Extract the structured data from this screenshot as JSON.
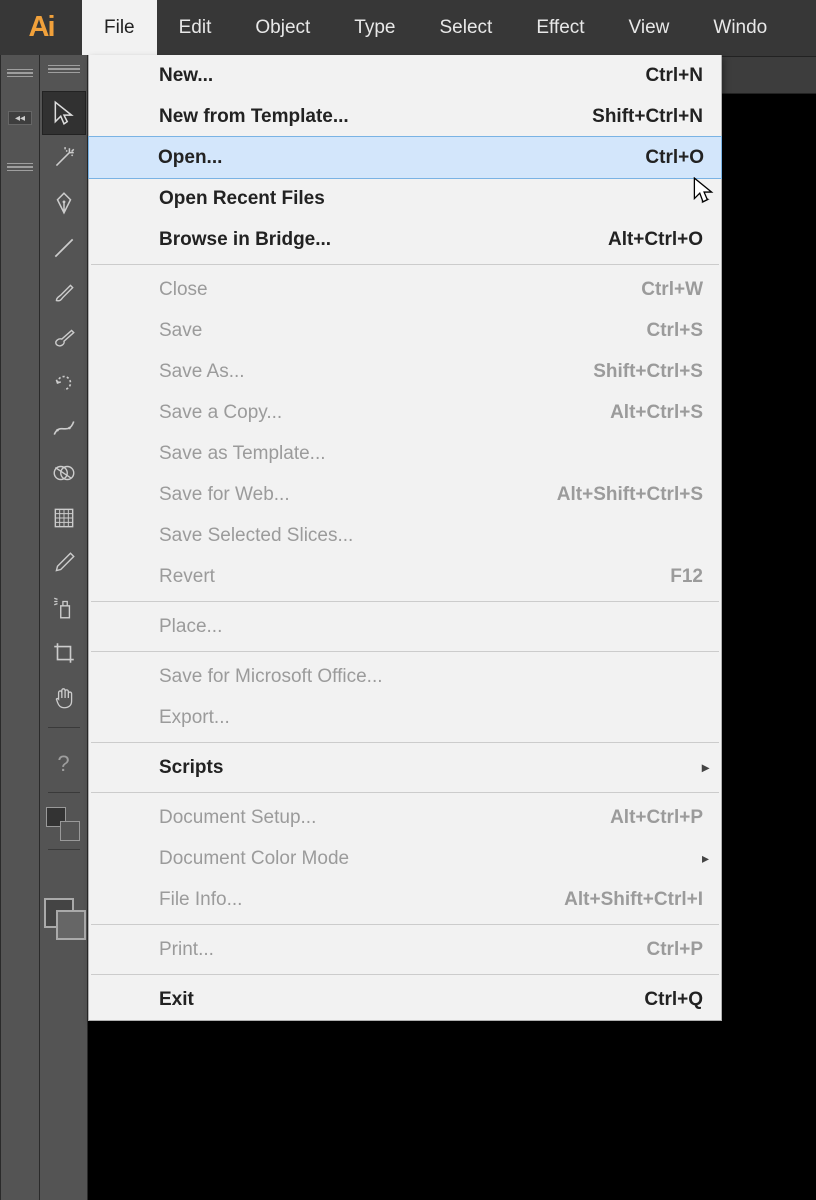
{
  "app_logo_text": "Ai",
  "menubar": {
    "items": [
      {
        "label": "File"
      },
      {
        "label": "Edit"
      },
      {
        "label": "Object"
      },
      {
        "label": "Type"
      },
      {
        "label": "Select"
      },
      {
        "label": "Effect"
      },
      {
        "label": "View"
      },
      {
        "label": "Windo"
      }
    ]
  },
  "file_menu": {
    "items": [
      {
        "label": "New...",
        "shortcut": "Ctrl+N",
        "disabled": false,
        "submenu": false,
        "hover": false
      },
      {
        "label": "New from Template...",
        "shortcut": "Shift+Ctrl+N",
        "disabled": false,
        "submenu": false,
        "hover": false
      },
      {
        "label": "Open...",
        "shortcut": "Ctrl+O",
        "disabled": false,
        "submenu": false,
        "hover": true
      },
      {
        "label": "Open Recent Files",
        "shortcut": "",
        "disabled": false,
        "submenu": true,
        "hover": false
      },
      {
        "label": "Browse in Bridge...",
        "shortcut": "Alt+Ctrl+O",
        "disabled": false,
        "submenu": false,
        "hover": false
      },
      {
        "sep": true
      },
      {
        "label": "Close",
        "shortcut": "Ctrl+W",
        "disabled": true,
        "submenu": false,
        "hover": false
      },
      {
        "label": "Save",
        "shortcut": "Ctrl+S",
        "disabled": true,
        "submenu": false,
        "hover": false
      },
      {
        "label": "Save As...",
        "shortcut": "Shift+Ctrl+S",
        "disabled": true,
        "submenu": false,
        "hover": false
      },
      {
        "label": "Save a Copy...",
        "shortcut": "Alt+Ctrl+S",
        "disabled": true,
        "submenu": false,
        "hover": false
      },
      {
        "label": "Save as Template...",
        "shortcut": "",
        "disabled": true,
        "submenu": false,
        "hover": false
      },
      {
        "label": "Save for Web...",
        "shortcut": "Alt+Shift+Ctrl+S",
        "disabled": true,
        "submenu": false,
        "hover": false
      },
      {
        "label": "Save Selected Slices...",
        "shortcut": "",
        "disabled": true,
        "submenu": false,
        "hover": false
      },
      {
        "label": "Revert",
        "shortcut": "F12",
        "disabled": true,
        "submenu": false,
        "hover": false
      },
      {
        "sep": true
      },
      {
        "label": "Place...",
        "shortcut": "",
        "disabled": true,
        "submenu": false,
        "hover": false
      },
      {
        "sep": true
      },
      {
        "label": "Save for Microsoft Office...",
        "shortcut": "",
        "disabled": true,
        "submenu": false,
        "hover": false
      },
      {
        "label": "Export...",
        "shortcut": "",
        "disabled": true,
        "submenu": false,
        "hover": false
      },
      {
        "sep": true
      },
      {
        "label": "Scripts",
        "shortcut": "",
        "disabled": false,
        "submenu": true,
        "hover": false
      },
      {
        "sep": true
      },
      {
        "label": "Document Setup...",
        "shortcut": "Alt+Ctrl+P",
        "disabled": true,
        "submenu": false,
        "hover": false
      },
      {
        "label": "Document Color Mode",
        "shortcut": "",
        "disabled": true,
        "submenu": true,
        "hover": false
      },
      {
        "label": "File Info...",
        "shortcut": "Alt+Shift+Ctrl+I",
        "disabled": true,
        "submenu": false,
        "hover": false
      },
      {
        "sep": true
      },
      {
        "label": "Print...",
        "shortcut": "Ctrl+P",
        "disabled": true,
        "submenu": false,
        "hover": false
      },
      {
        "sep": true
      },
      {
        "label": "Exit",
        "shortcut": "Ctrl+Q",
        "disabled": false,
        "submenu": false,
        "hover": false
      }
    ]
  },
  "tools": [
    {
      "name": "selection-tool",
      "selected": true
    },
    {
      "name": "magic-wand-tool",
      "selected": false
    },
    {
      "name": "pen-tool",
      "selected": false
    },
    {
      "name": "line-tool",
      "selected": false
    },
    {
      "name": "paintbrush-tool",
      "selected": false
    },
    {
      "name": "blob-brush-tool",
      "selected": false
    },
    {
      "name": "rotate-tool",
      "selected": false
    },
    {
      "name": "width-tool",
      "selected": false
    },
    {
      "name": "shape-builder-tool",
      "selected": false
    },
    {
      "name": "mesh-tool",
      "selected": false
    },
    {
      "name": "eyedropper-tool",
      "selected": false
    },
    {
      "name": "symbol-sprayer-tool",
      "selected": false
    },
    {
      "name": "artboard-tool",
      "selected": false
    },
    {
      "name": "hand-tool",
      "selected": false
    }
  ],
  "help_button": "?"
}
